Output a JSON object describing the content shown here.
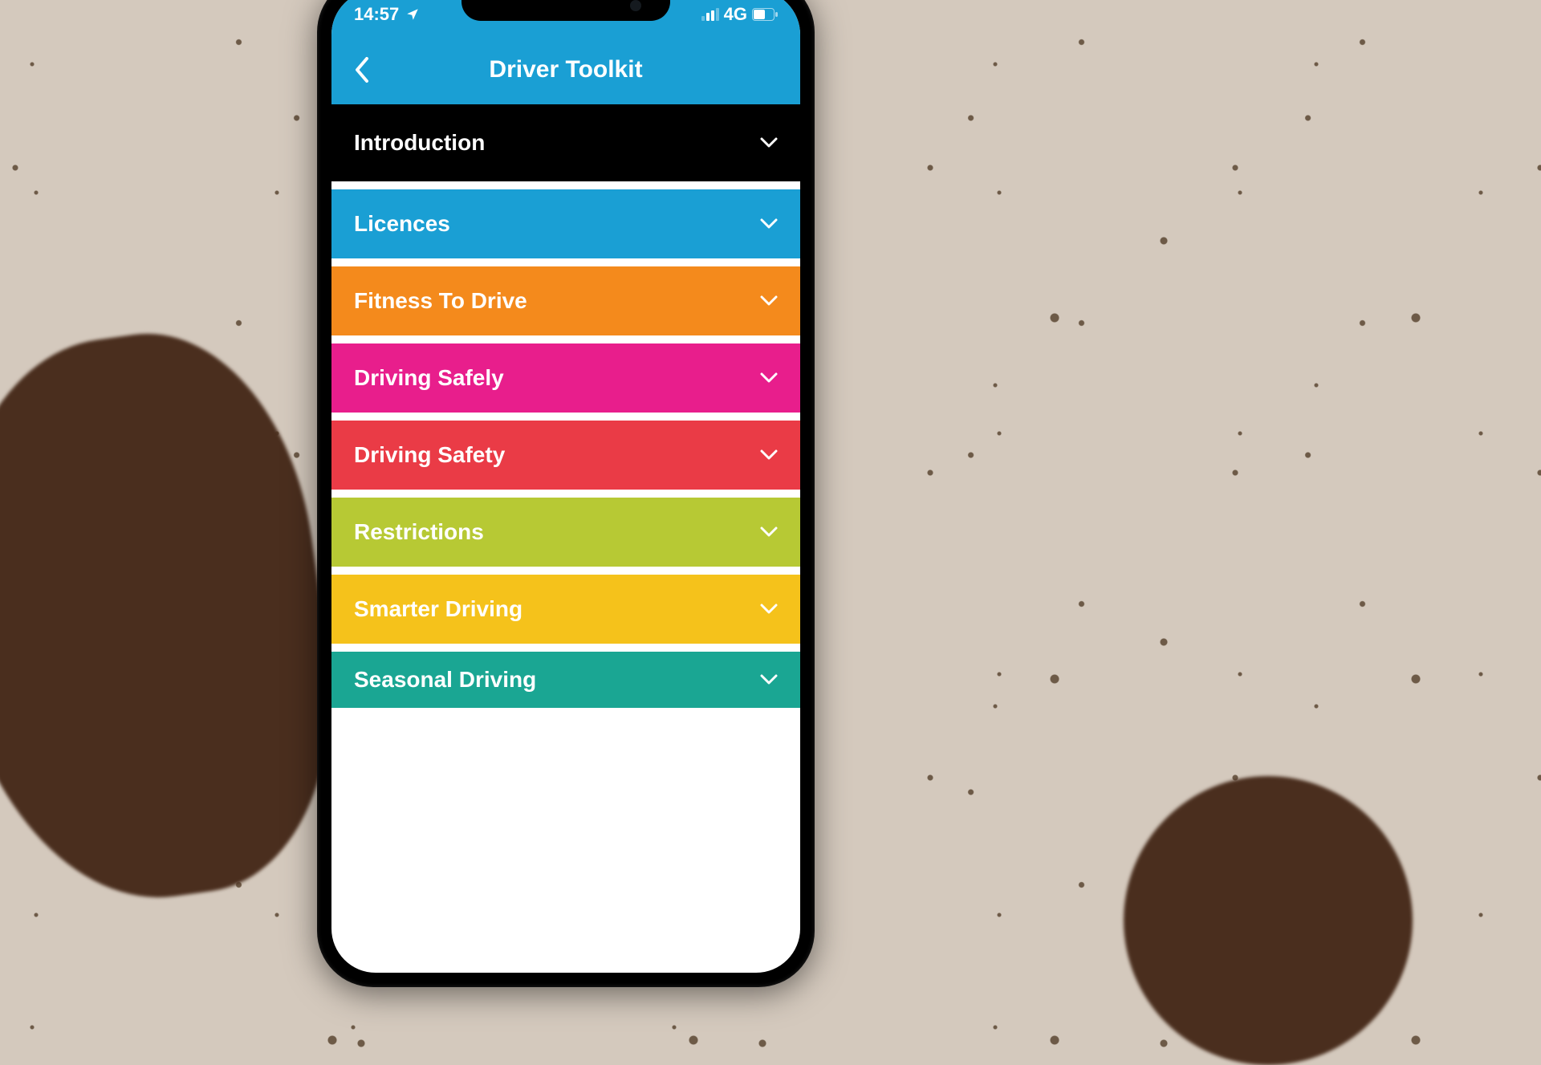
{
  "statusbar": {
    "time": "14:57",
    "network": "4G"
  },
  "header": {
    "title": "Driver Toolkit"
  },
  "rows": [
    {
      "label": "Introduction",
      "color": "#000000"
    },
    {
      "label": "Licences",
      "color": "#1a9fd4"
    },
    {
      "label": "Fitness To Drive",
      "color": "#f48a1c"
    },
    {
      "label": "Driving Safely",
      "color": "#e81e8c"
    },
    {
      "label": "Driving Safety",
      "color": "#ea3b46"
    },
    {
      "label": "Restrictions",
      "color": "#b7c934"
    },
    {
      "label": "Smarter Driving",
      "color": "#f5c21b"
    },
    {
      "label": "Seasonal Driving",
      "color": "#1aa693"
    }
  ]
}
